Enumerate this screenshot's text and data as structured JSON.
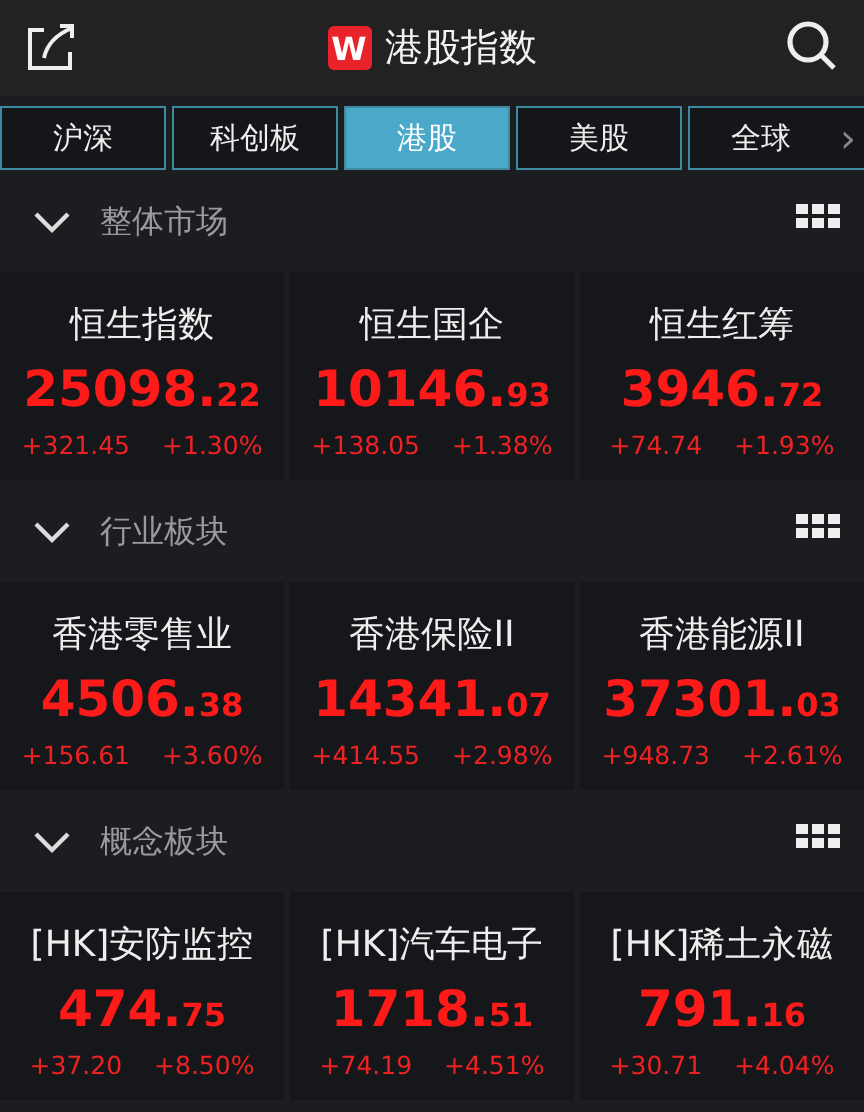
{
  "header": {
    "logo": "W",
    "title": "港股指数"
  },
  "tabs": [
    {
      "label": "沪深",
      "selected": false
    },
    {
      "label": "科创板",
      "selected": false
    },
    {
      "label": "港股",
      "selected": true
    },
    {
      "label": "美股",
      "selected": false
    },
    {
      "label": "全球",
      "selected": false
    }
  ],
  "tabs_more": "›",
  "sections": [
    {
      "title": "整体市场",
      "expanded": true,
      "cards": [
        {
          "name": "恒生指数",
          "price": "25098.",
          "decimals": "22",
          "change": "+321.45",
          "percent": "+1.30%"
        },
        {
          "name": "恒生国企",
          "price": "10146.",
          "decimals": "93",
          "change": "+138.05",
          "percent": "+1.38%"
        },
        {
          "name": "恒生红筹",
          "price": "3946.",
          "decimals": "72",
          "change": "+74.74",
          "percent": "+1.93%"
        }
      ]
    },
    {
      "title": "行业板块",
      "expanded": true,
      "cards": [
        {
          "name": "香港零售业",
          "price": "4506.",
          "decimals": "38",
          "change": "+156.61",
          "percent": "+3.60%"
        },
        {
          "name": "香港保险II",
          "price": "14341.",
          "decimals": "07",
          "change": "+414.55",
          "percent": "+2.98%"
        },
        {
          "name": "香港能源II",
          "price": "37301.",
          "decimals": "03",
          "change": "+948.73",
          "percent": "+2.61%"
        }
      ]
    },
    {
      "title": "概念板块",
      "expanded": true,
      "cards": [
        {
          "name": "[HK]安防监控",
          "price": "474.",
          "decimals": "75",
          "change": "+37.20",
          "percent": "+8.50%"
        },
        {
          "name": "[HK]汽车电子",
          "price": "1718.",
          "decimals": "51",
          "change": "+74.19",
          "percent": "+4.51%"
        },
        {
          "name": "[HK]稀土永磁",
          "price": "791.",
          "decimals": "16",
          "change": "+30.71",
          "percent": "+4.04%"
        }
      ]
    }
  ]
}
